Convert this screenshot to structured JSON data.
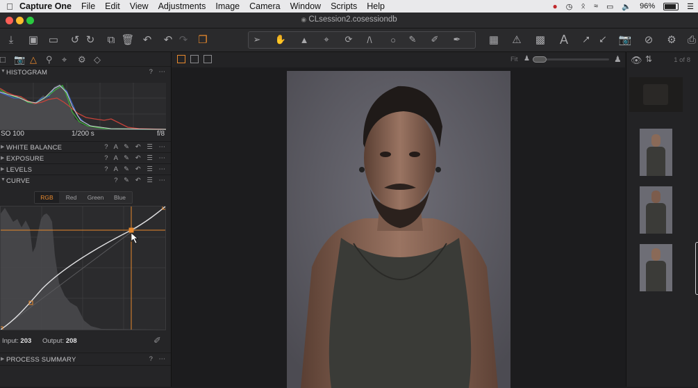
{
  "menubar": {
    "app_name": "Capture One",
    "items": [
      "File",
      "Edit",
      "View",
      "Adjustments",
      "Image",
      "Camera",
      "Window",
      "Scripts",
      "Help"
    ],
    "battery": "96%"
  },
  "window": {
    "title": "CLsession2.cosessiondb"
  },
  "histogram": {
    "title": "HISTOGRAM",
    "iso": "SO 100",
    "shutter": "1/200 s",
    "aperture": "f/8"
  },
  "tools": {
    "white_balance": "WHITE BALANCE",
    "exposure": "EXPOSURE",
    "levels": "LEVELS",
    "curve": "CURVE",
    "process_summary": "PROCESS SUMMARY"
  },
  "curve": {
    "tabs": [
      "RGB",
      "Red",
      "Green",
      "Blue"
    ],
    "active_tab": "RGB",
    "input_label": "Input:",
    "input_value": "203",
    "output_label": "Output:",
    "output_value": "208"
  },
  "viewer": {
    "zoom_label": "Fit"
  },
  "browser": {
    "count": "1 of 8"
  },
  "colors": {
    "accent": "#e8892d",
    "panel_bg": "#252527",
    "viewer_bg": "#1c1c1e"
  }
}
